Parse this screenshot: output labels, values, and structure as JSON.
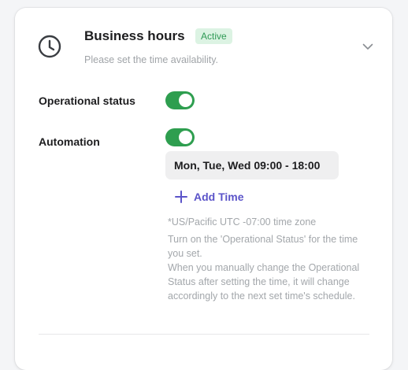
{
  "header": {
    "title": "Business hours",
    "status_badge": "Active",
    "subtitle": "Please set the time availability."
  },
  "settings": {
    "operational_status": {
      "label": "Operational status",
      "enabled": true
    },
    "automation": {
      "label": "Automation",
      "enabled": true
    }
  },
  "schedule": {
    "entries": [
      "Mon, Tue, Wed 09:00 - 18:00"
    ],
    "add_time_label": "Add Time"
  },
  "notes": {
    "timezone": "*US/Pacific UTC -07:00 time zone",
    "instruction": "Turn on the 'Operational Status' for the time you set.",
    "explanation": "When you manually change the Operational Status after setting the time, it will change accordingly to the next set time's schedule."
  },
  "icons": {
    "header_icon": "clock-icon",
    "collapse_icon": "chevron-down-icon",
    "add_icon": "plus-icon"
  },
  "colors": {
    "toggle_on": "#2e9e4f",
    "badge_text": "#2f9a55",
    "badge_bg": "#dcf3e3",
    "accent_link": "#5b54c9"
  }
}
